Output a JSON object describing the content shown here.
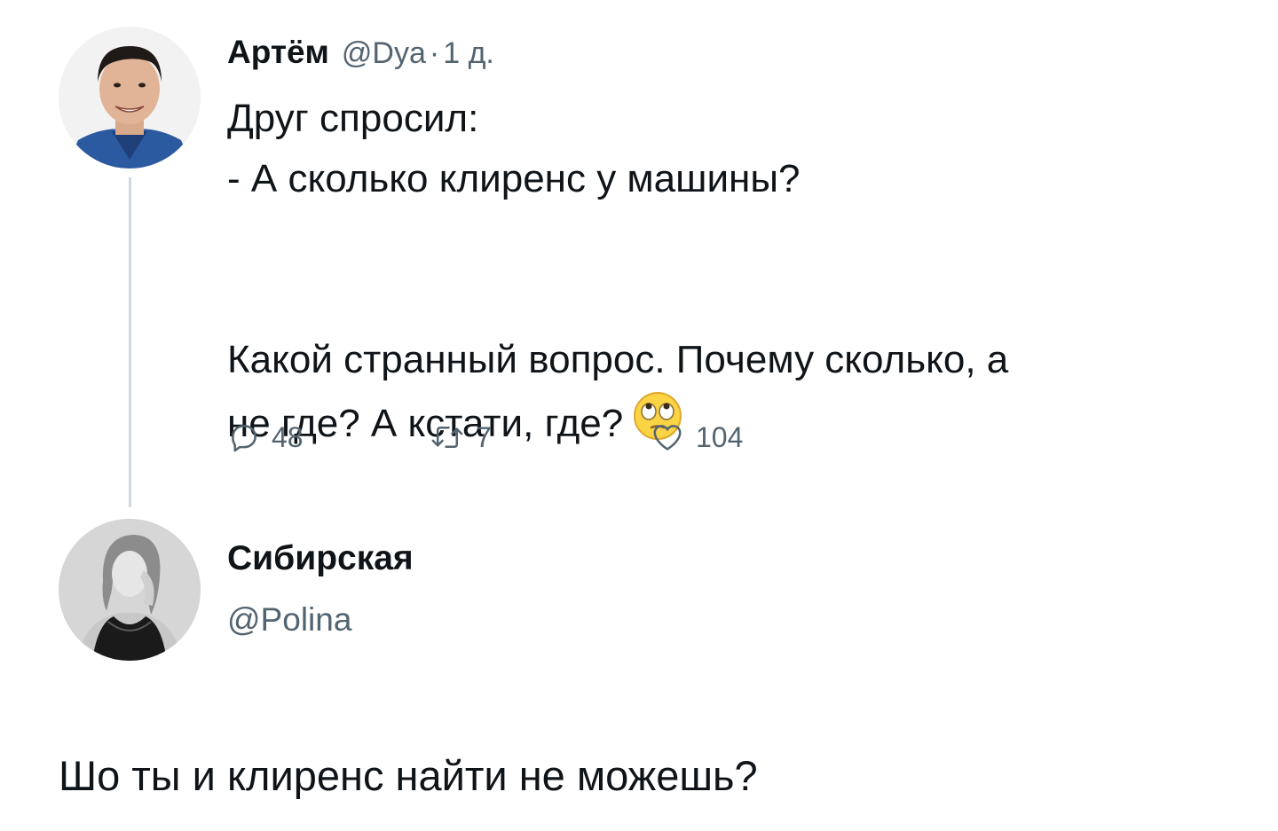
{
  "thread": {
    "tweet1": {
      "author_name": "Артём",
      "handle": "@Dya",
      "separator": "·",
      "time": "1 д.",
      "lines": [
        "Друг спросил:",
        "- А сколько клиренс у машины?",
        "Какой странный вопрос. Почему сколько, а",
        "не где? А кстати, где?"
      ],
      "emoji_icon": "eye-roll-emoji-icon",
      "actions": {
        "reply_icon": "reply-icon",
        "reply_count": "48",
        "retweet_icon": "retweet-icon",
        "retweet_count": "7",
        "like_icon": "heart-icon",
        "like_count": "104"
      }
    },
    "tweet2": {
      "author_name": "Сибирская",
      "handle": "@Polina",
      "text": "Шо ты и клиренс найти не можешь?"
    }
  },
  "colors": {
    "text_primary": "#0f1419",
    "text_secondary": "#536471",
    "thread_line": "#cfd9de",
    "background": "#ffffff"
  }
}
